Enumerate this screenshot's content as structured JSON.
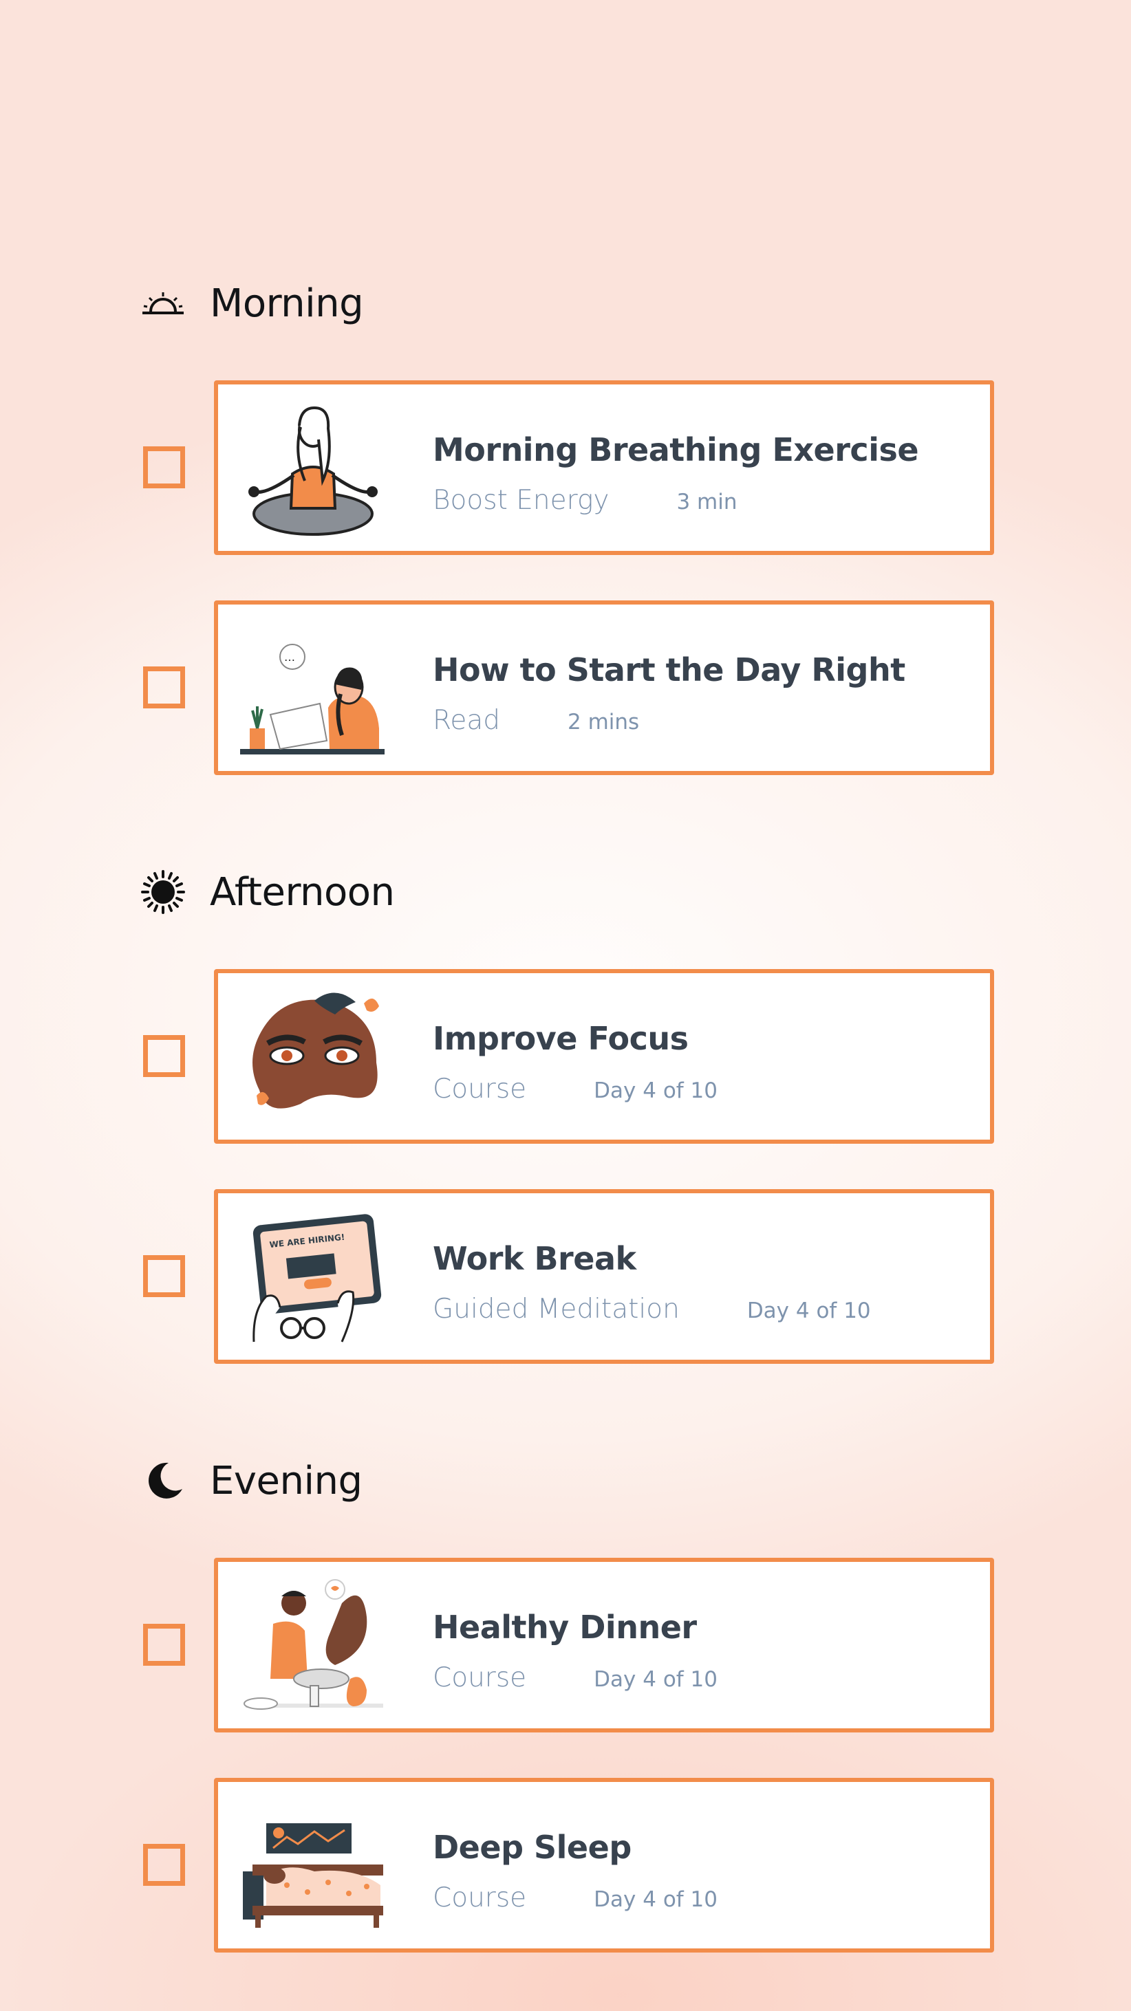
{
  "colors": {
    "accent": "#f28c4a",
    "title": "#38424e",
    "subtitle": "#7e93ad",
    "heading": "#121417"
  },
  "sections": [
    {
      "title": "Morning",
      "icon": "sunrise-icon",
      "items": [
        {
          "title": "Morning Breathing Exercise",
          "type": "Boost Energy",
          "meta": "3 min",
          "illustration": "meditation-illustration",
          "checked": false
        },
        {
          "title": "How to Start the Day Right",
          "type": "Read",
          "meta": "2 mins",
          "illustration": "reading-illustration",
          "checked": false
        }
      ]
    },
    {
      "title": "Afternoon",
      "icon": "sun-icon",
      "items": [
        {
          "title": "Improve Focus",
          "type": "Course",
          "meta": "Day 4 of 10",
          "illustration": "focus-eyes-illustration",
          "checked": false
        },
        {
          "title": "Work Break",
          "type": "Guided Meditation",
          "meta": "Day 4 of 10",
          "illustration": "tablet-hiring-illustration",
          "checked": false,
          "illustration_text": "WE ARE HIRING!"
        }
      ]
    },
    {
      "title": "Evening",
      "icon": "moon-icon",
      "items": [
        {
          "title": "Healthy Dinner",
          "type": "Course",
          "meta": "Day 4 of 10",
          "illustration": "cooking-illustration",
          "checked": false
        },
        {
          "title": "Deep Sleep",
          "type": "Course",
          "meta": "Day 4 of 10",
          "illustration": "sleeping-illustration",
          "checked": false
        }
      ]
    }
  ]
}
